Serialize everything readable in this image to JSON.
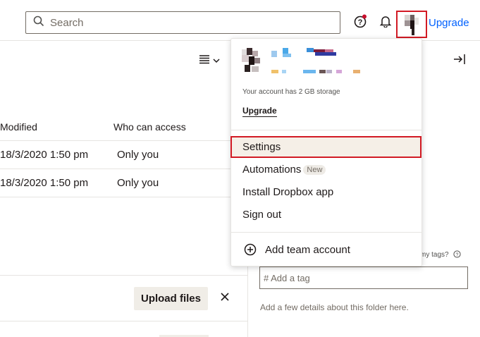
{
  "topbar": {
    "search_placeholder": "Search",
    "upgrade_label": "Upgrade"
  },
  "file_list": {
    "columns": [
      "Modified",
      "Who can access"
    ],
    "rows": [
      {
        "modified": "18/3/2020 1:50 pm",
        "access": "Only you"
      },
      {
        "modified": "18/3/2020 1:50 pm",
        "access": "Only you"
      }
    ]
  },
  "upload_bar": {
    "upload_label": "Upload files"
  },
  "account_menu": {
    "storage_text": "Your account has 2 GB storage",
    "upgrade_label": "Upgrade",
    "items": [
      {
        "label": "Settings",
        "selected": true
      },
      {
        "label": "Automations",
        "badge": "New"
      },
      {
        "label": "Install Dropbox app"
      },
      {
        "label": "Sign out"
      }
    ],
    "add_team_label": "Add team account"
  },
  "details_panel": {
    "tags_hint": "my tags?",
    "tag_placeholder": "# Add a tag",
    "details_hint": "Add a few details about this folder here."
  },
  "colors": {
    "accent": "#0061fe",
    "highlight": "#d21a24",
    "notification": "#c8102e"
  }
}
